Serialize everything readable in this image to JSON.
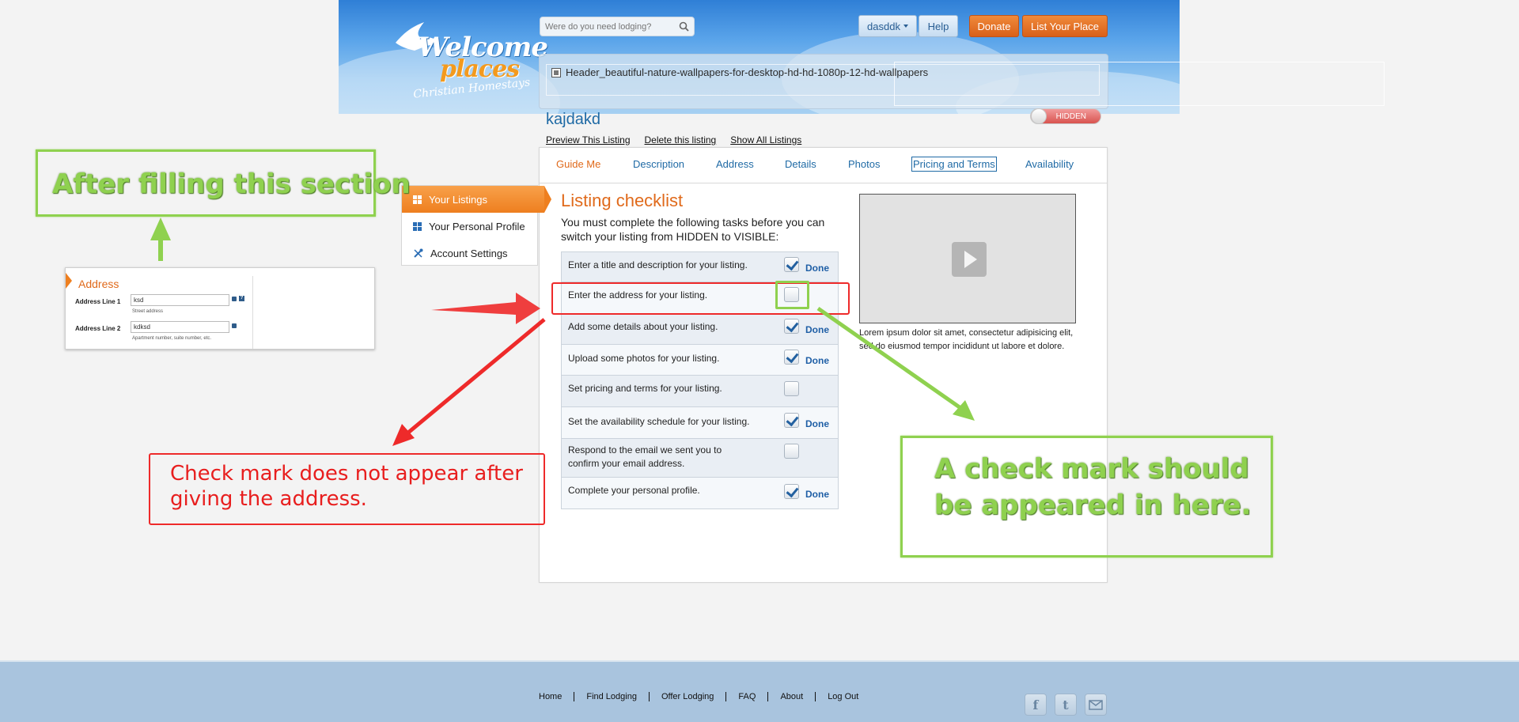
{
  "header": {
    "logo": {
      "line1": "Welcome",
      "line2": "places",
      "line3": "Christian Homestays"
    },
    "search": {
      "placeholder": "Were do you need lodging?"
    },
    "user_label": "dasddk",
    "help_label": "Help",
    "donate_label": "Donate",
    "list_place_label": "List Your Place",
    "banner_alt": "Header_beautiful-nature-wallpapers-for-desktop-hd-hd-1080p-12-hd-wallpapers"
  },
  "listing": {
    "title": "kajdakd",
    "visibility": "HIDDEN",
    "links": [
      "Preview This Listing",
      "Delete this listing",
      "Show All Listings"
    ]
  },
  "tabs": [
    "Guide Me",
    "Description",
    "Address",
    "Details",
    "Photos",
    "Pricing and Terms",
    "Availability"
  ],
  "active_tab": "Guide Me",
  "checklist": {
    "title": "Listing checklist",
    "intro": "You must complete the following tasks before you can switch your listing from HIDDEN to VISIBLE:",
    "done_label": "Done",
    "items": [
      {
        "text": "Enter a title and description for your listing.",
        "checked": true
      },
      {
        "text": "Enter the address for your listing.",
        "checked": false
      },
      {
        "text": "Add some details about your listing.",
        "checked": true
      },
      {
        "text": "Upload some photos for your listing.",
        "checked": true
      },
      {
        "text": "Set pricing and terms for your listing.",
        "checked": false
      },
      {
        "text": "Set the availability schedule for your listing.",
        "checked": true
      },
      {
        "text": "Respond to the email we sent you to confirm your email address.",
        "checked": false
      },
      {
        "text": "Complete your personal profile.",
        "checked": true
      }
    ]
  },
  "video": {
    "caption": "Lorem ipsum dolor sit amet, consectetur adipisicing elit, sed do eiusmod tempor incididunt ut labore et dolore."
  },
  "side_menu": {
    "items": [
      "Your Listings",
      "Your Personal Profile",
      "Account Settings"
    ]
  },
  "address_preview": {
    "title": "Address",
    "line1_label": "Address Line 1",
    "line1_value": "ksd",
    "line1_hint": "Street address",
    "line2_label": "Address Line 2",
    "line2_value": "kdksd",
    "line2_hint": "Apartment number, suite number, etc."
  },
  "annotations": {
    "after_filling": "After filling this section",
    "check_missing": "Check mark does not appear after giving the address.",
    "check_expected": "A check mark should be appeared in here."
  },
  "footer": {
    "links": [
      "Home",
      "Find Lodging",
      "Offer Lodging",
      "FAQ",
      "About",
      "Log Out"
    ],
    "social": [
      "facebook-icon",
      "twitter-icon",
      "email-icon"
    ]
  },
  "colors": {
    "accent_orange": "#e06a1b",
    "link_blue": "#1f6aa5",
    "annotation_green": "#8fd14f",
    "annotation_red": "#ee2a2a",
    "footer_bg": "#a9c4de"
  }
}
